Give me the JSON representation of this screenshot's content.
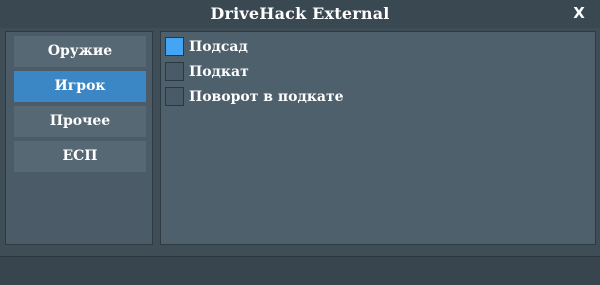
{
  "window": {
    "title": "DriveHack External",
    "close_label": "X"
  },
  "sidebar": {
    "items": [
      {
        "label": "Оружие",
        "active": false
      },
      {
        "label": "Игрок",
        "active": true
      },
      {
        "label": "Прочее",
        "active": false
      },
      {
        "label": "ЕСП",
        "active": false
      }
    ]
  },
  "options": [
    {
      "label": "Подсад",
      "checked": true
    },
    {
      "label": "Подкат",
      "checked": false
    },
    {
      "label": "Поворот в подкате",
      "checked": false
    }
  ],
  "colors": {
    "accent": "#3b86c4",
    "checked": "#45a5f5",
    "background": "#3f4d57",
    "panel": "#4e606c"
  }
}
